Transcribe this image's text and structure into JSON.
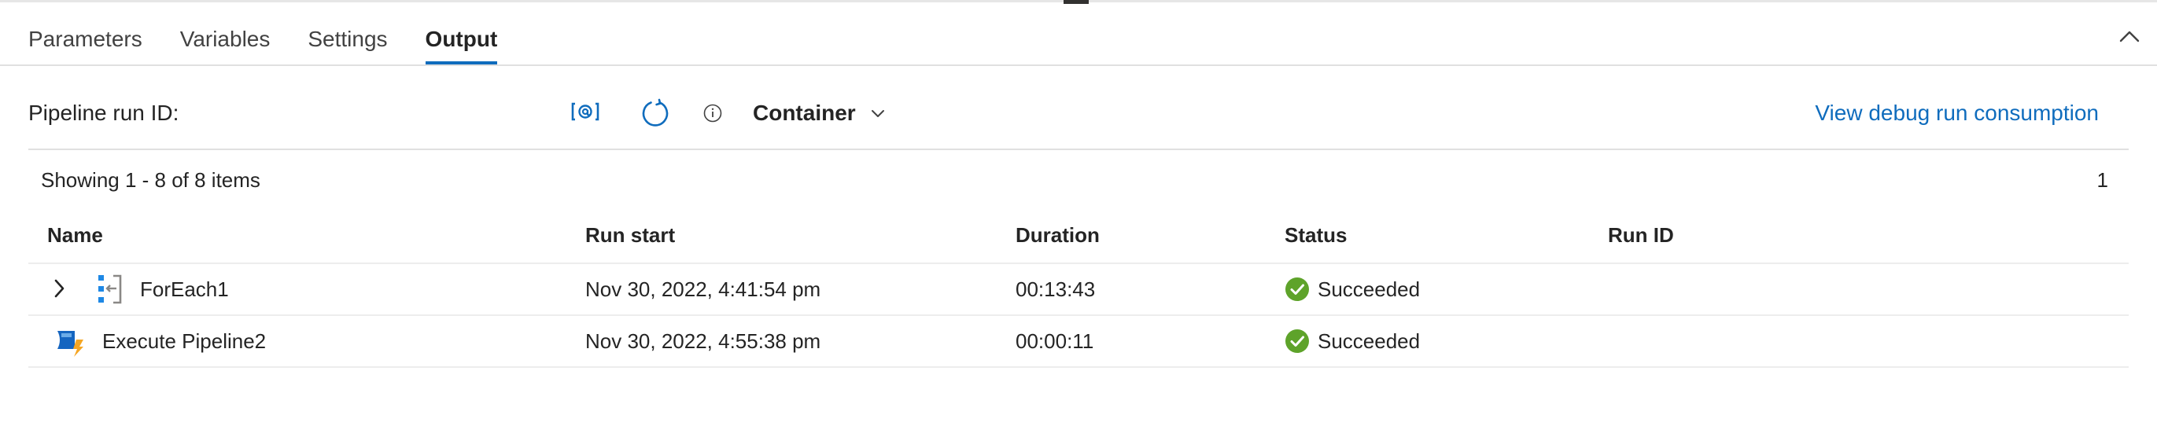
{
  "tabs": [
    {
      "label": "Parameters",
      "active": false
    },
    {
      "label": "Variables",
      "active": false
    },
    {
      "label": "Settings",
      "active": false
    },
    {
      "label": "Output",
      "active": true
    }
  ],
  "toolbar": {
    "run_id_label": "Pipeline run ID:",
    "container_label": "Container",
    "debug_link": "View debug run consumption"
  },
  "list": {
    "showing_text": "Showing 1 - 8 of 8 items",
    "page_number": "1"
  },
  "table": {
    "columns": [
      "Name",
      "Run start",
      "Duration",
      "Status",
      "Run ID"
    ],
    "rows": [
      {
        "name": "ForEach1",
        "icon": "foreach-activity-icon",
        "expandable": true,
        "run_start": "Nov 30, 2022, 4:41:54 pm",
        "duration": "00:13:43",
        "status": "Succeeded",
        "run_id": ""
      },
      {
        "name": "Execute Pipeline2",
        "icon": "execute-pipeline-icon",
        "expandable": false,
        "run_start": "Nov 30, 2022, 4:55:38 pm",
        "duration": "00:00:11",
        "status": "Succeeded",
        "run_id": ""
      }
    ]
  },
  "colors": {
    "accent": "#0f6cbd",
    "success": "#5ea32a",
    "text": "#242424"
  }
}
